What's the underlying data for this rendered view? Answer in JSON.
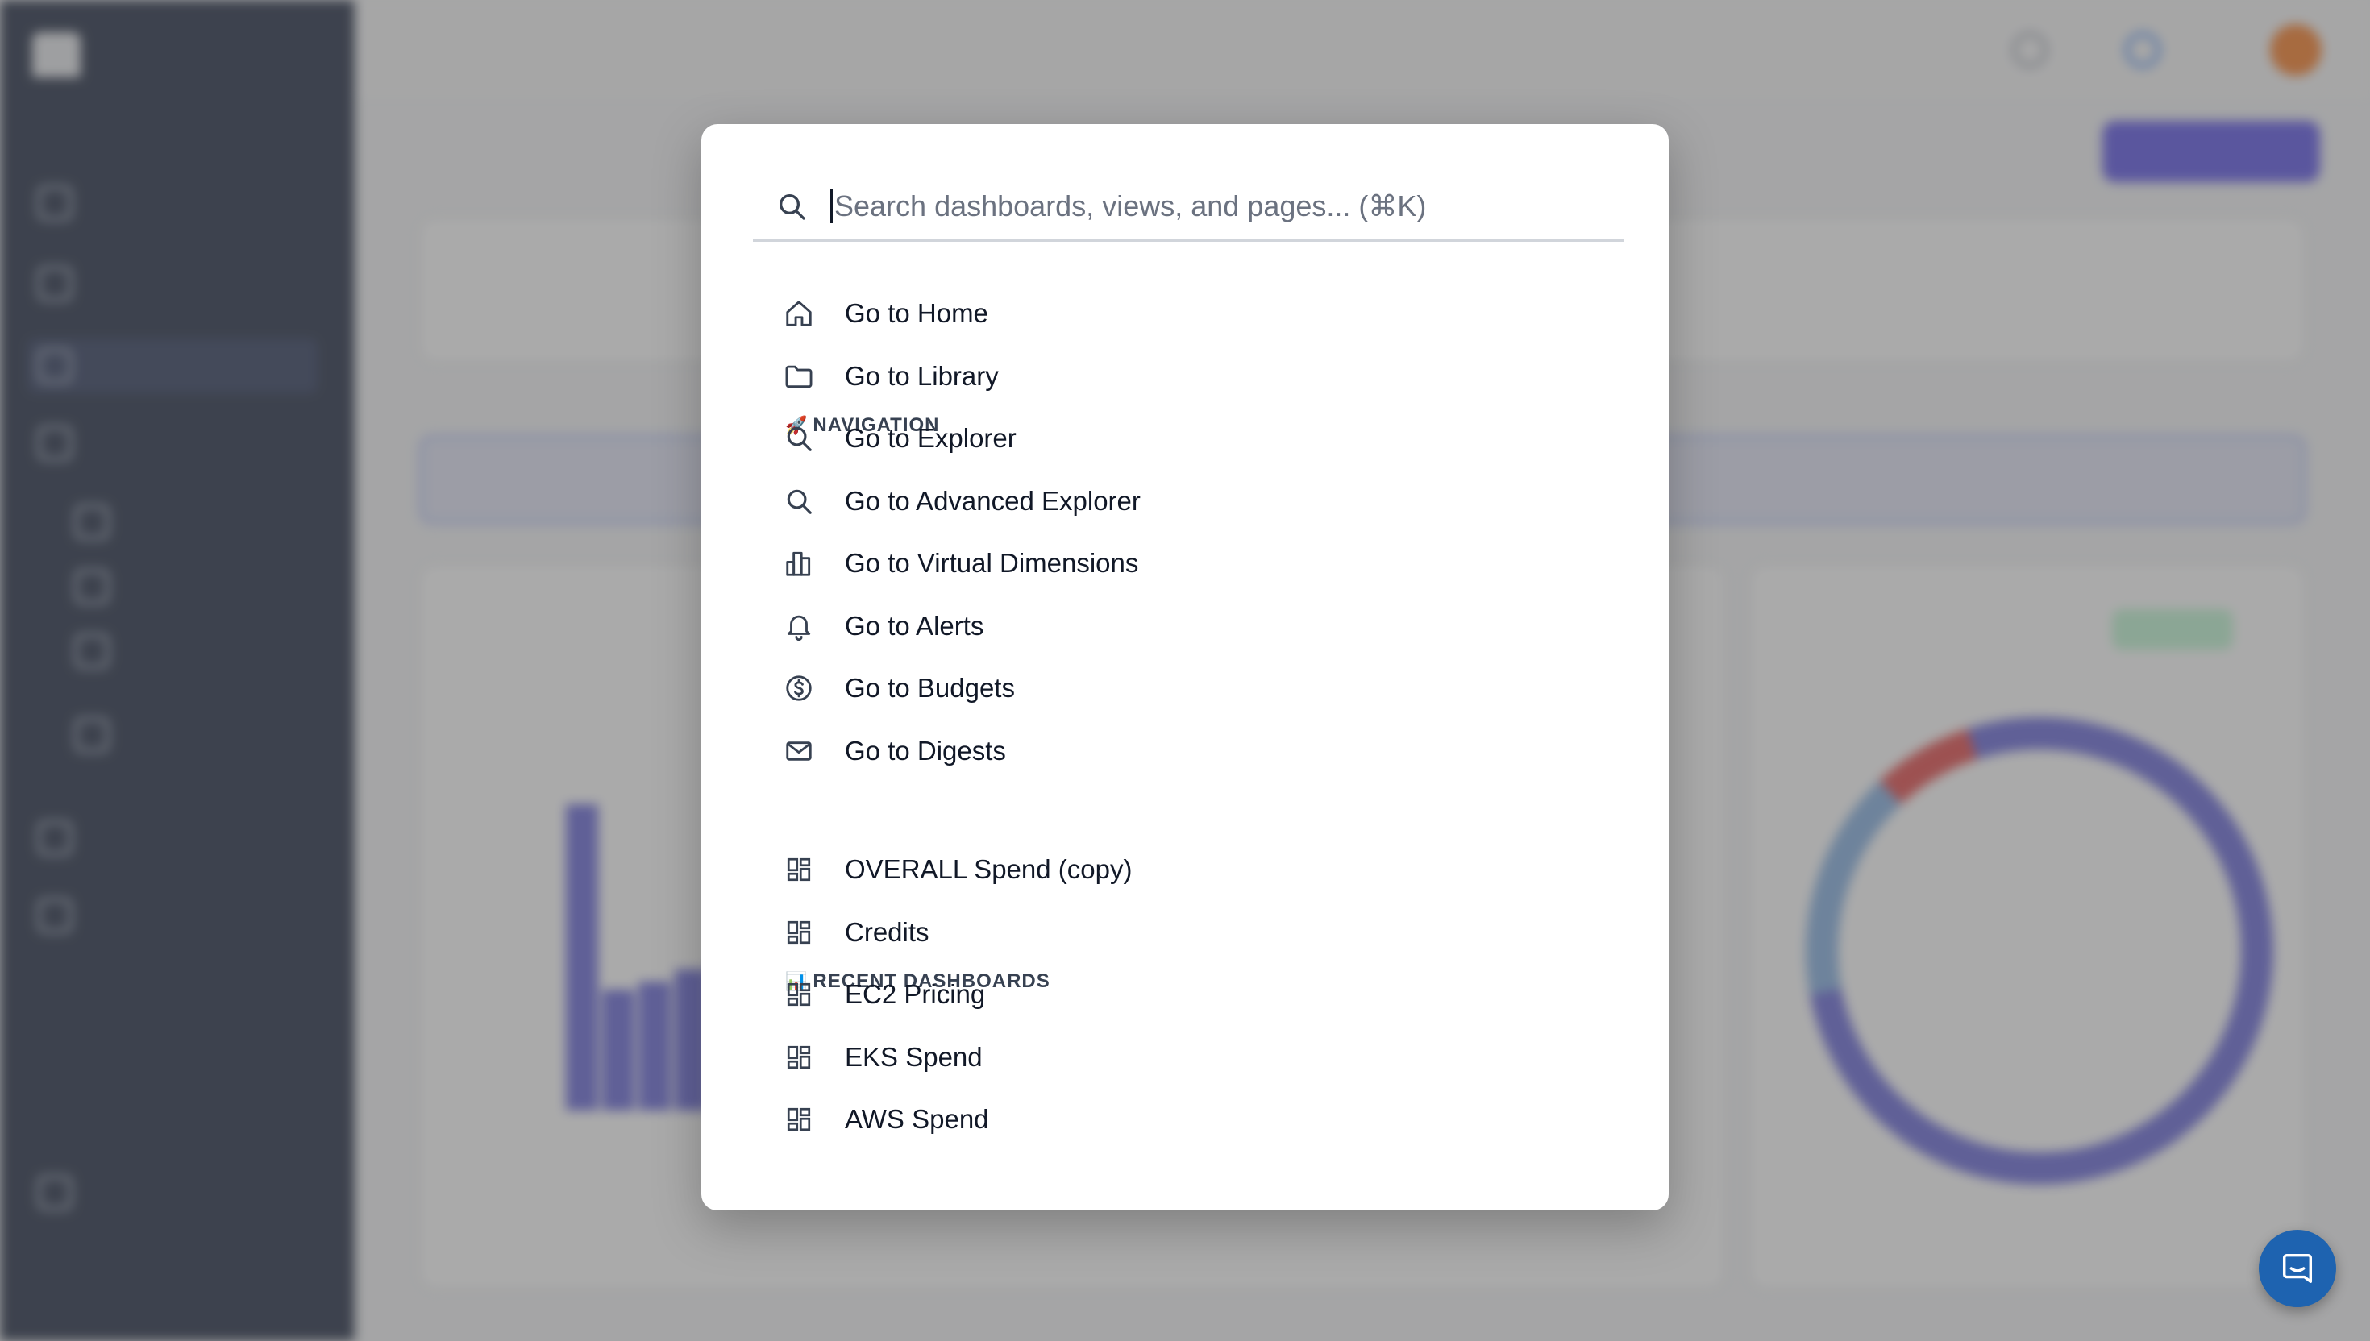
{
  "search": {
    "placeholder": "Search dashboards, views, and pages... (⌘K)",
    "value": ""
  },
  "sections": {
    "navigation": {
      "emoji": "🚀",
      "title": "NAVIGATION",
      "items": [
        {
          "label": "Go to Home",
          "icon": "home-icon"
        },
        {
          "label": "Go to Library",
          "icon": "folder-icon"
        },
        {
          "label": "Go to Explorer",
          "icon": "search-icon"
        },
        {
          "label": "Go to Advanced Explorer",
          "icon": "search-icon"
        },
        {
          "label": "Go to Virtual Dimensions",
          "icon": "bar-chart-icon"
        },
        {
          "label": "Go to Alerts",
          "icon": "bell-icon"
        },
        {
          "label": "Go to Budgets",
          "icon": "dollar-circle-icon"
        },
        {
          "label": "Go to Digests",
          "icon": "mail-icon"
        }
      ]
    },
    "recent_dashboards": {
      "emoji": "📊",
      "title": "RECENT DASHBOARDS",
      "items": [
        {
          "label": "OVERALL Spend (copy)",
          "icon": "dashboard-icon"
        },
        {
          "label": "Credits",
          "icon": "dashboard-icon"
        },
        {
          "label": "EC2 Pricing",
          "icon": "dashboard-icon"
        },
        {
          "label": "EKS Spend",
          "icon": "dashboard-icon"
        },
        {
          "label": "AWS Spend",
          "icon": "dashboard-icon"
        }
      ]
    }
  },
  "chat_widget": {
    "icon": "chat-icon"
  },
  "colors": {
    "sidebar_bg": "#0f1a33",
    "accent": "#4f46e5",
    "chat_bubble": "#1e63b0",
    "modal_bg": "#ffffff"
  }
}
